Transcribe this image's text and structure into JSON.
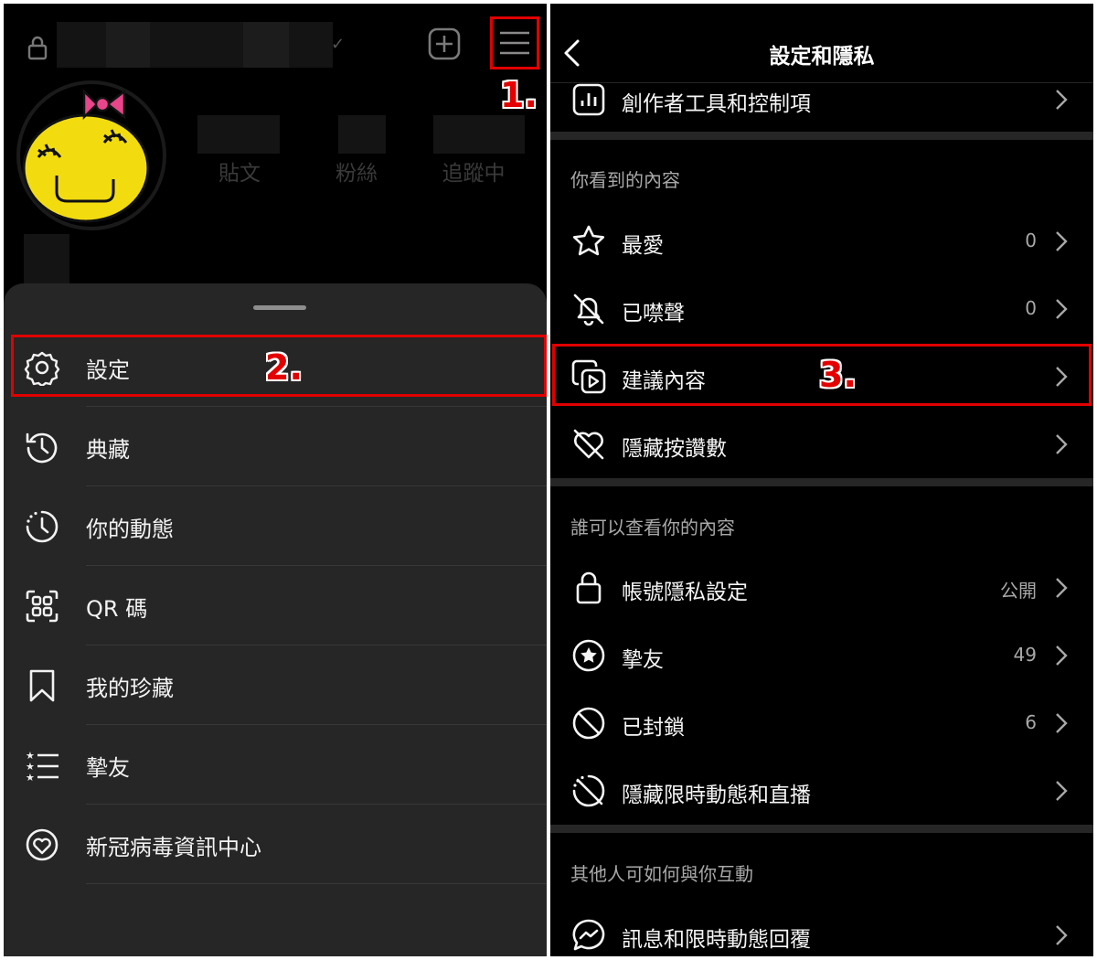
{
  "profile": {
    "stats": [
      {
        "label": "貼文"
      },
      {
        "label": "粉絲"
      },
      {
        "label": "追蹤中"
      }
    ]
  },
  "menu": {
    "items": [
      {
        "icon": "gear-icon",
        "label": "設定"
      },
      {
        "icon": "archive-history-icon",
        "label": "典藏"
      },
      {
        "icon": "activity-icon",
        "label": "你的動態"
      },
      {
        "icon": "qr-code-icon",
        "label": "QR 碼"
      },
      {
        "icon": "bookmark-icon",
        "label": "我的珍藏"
      },
      {
        "icon": "close-friends-icon",
        "label": "摯友"
      },
      {
        "icon": "covid-info-icon",
        "label": "新冠病毒資訊中心"
      }
    ]
  },
  "settings": {
    "title": "設定和隱私",
    "top_item": {
      "icon": "bar-chart-icon",
      "label": "創作者工具和控制項"
    },
    "sections": [
      {
        "header": "你看到的內容",
        "items": [
          {
            "icon": "star-icon",
            "label": "最愛",
            "value": "0"
          },
          {
            "icon": "bell-off-icon",
            "label": "已噤聲",
            "value": "0"
          },
          {
            "icon": "suggested-content-icon",
            "label": "建議內容",
            "value": ""
          },
          {
            "icon": "heart-off-icon",
            "label": "隱藏按讚數",
            "value": ""
          }
        ]
      },
      {
        "header": "誰可以查看你的內容",
        "items": [
          {
            "icon": "lock-icon",
            "label": "帳號隱私設定",
            "value": "公開"
          },
          {
            "icon": "star-circle-icon",
            "label": "摯友",
            "value": "49"
          },
          {
            "icon": "block-icon",
            "label": "已封鎖",
            "value": "6"
          },
          {
            "icon": "story-off-icon",
            "label": "隱藏限時動態和直播",
            "value": ""
          }
        ]
      },
      {
        "header": "其他人可如何與你互動",
        "items": [
          {
            "icon": "messenger-icon",
            "label": "訊息和限時動態回覆",
            "value": ""
          }
        ]
      }
    ]
  },
  "annotations": {
    "step1": "1.",
    "step2": "2.",
    "step3": "3.",
    "highlight_color": "#e10000"
  }
}
